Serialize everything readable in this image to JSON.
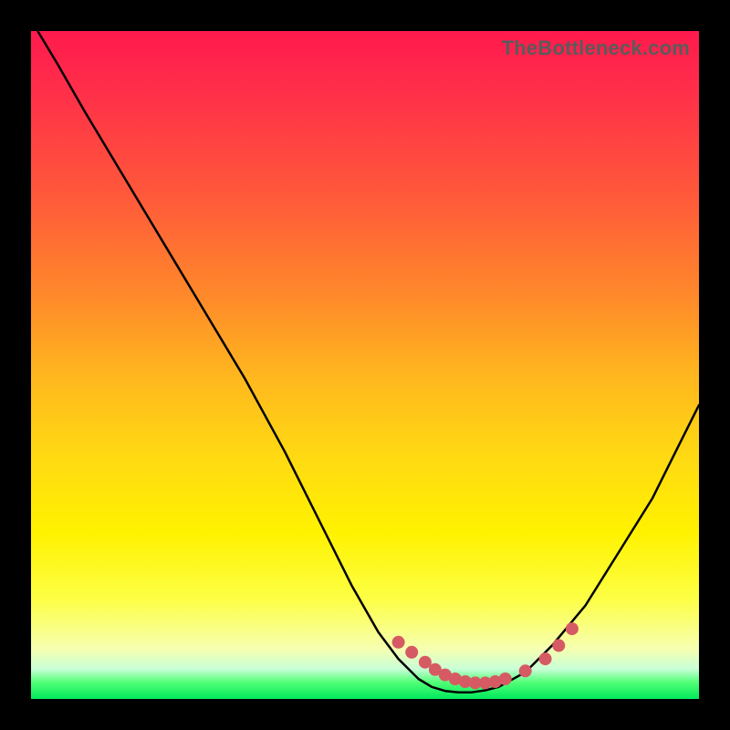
{
  "attribution": "TheBottleneck.com",
  "colors": {
    "frame": "#000000",
    "curve_stroke": "#000000",
    "marker_fill": "#d65a63",
    "gradient_stops": [
      "#ff1a4d",
      "#ff2c4a",
      "#ff5a3a",
      "#ff8a2a",
      "#ffb81e",
      "#ffda12",
      "#fff200",
      "#fdff45",
      "#f6ffb0",
      "#c8ffd7",
      "#52ff77",
      "#00e85b"
    ]
  },
  "chart_data": {
    "type": "line",
    "title": "",
    "xlabel": "",
    "ylabel": "",
    "xlim": [
      0,
      100
    ],
    "ylim": [
      0,
      100
    ],
    "grid": false,
    "legend": false,
    "series": [
      {
        "name": "curve",
        "x": [
          1,
          4,
          8,
          14,
          20,
          26,
          32,
          38,
          44,
          48,
          52,
          55,
          58,
          60,
          62,
          64,
          66,
          68,
          70,
          74,
          78,
          83,
          88,
          93,
          97,
          100
        ],
        "y": [
          100,
          95,
          88,
          78,
          68,
          58,
          48,
          37,
          25,
          17,
          10,
          6,
          3,
          1.8,
          1.2,
          1,
          1,
          1.3,
          1.8,
          4,
          8,
          14,
          22,
          30,
          38,
          44
        ]
      }
    ],
    "markers": {
      "name": "highlighted-points",
      "x": [
        55,
        57,
        59,
        60.5,
        62,
        63.5,
        65,
        66.5,
        68,
        69.5,
        71,
        74,
        77,
        79,
        81
      ],
      "y": [
        8.5,
        7,
        5.5,
        4.4,
        3.6,
        3.0,
        2.6,
        2.4,
        2.4,
        2.6,
        3.0,
        4.2,
        6.0,
        8.0,
        10.5
      ]
    }
  }
}
